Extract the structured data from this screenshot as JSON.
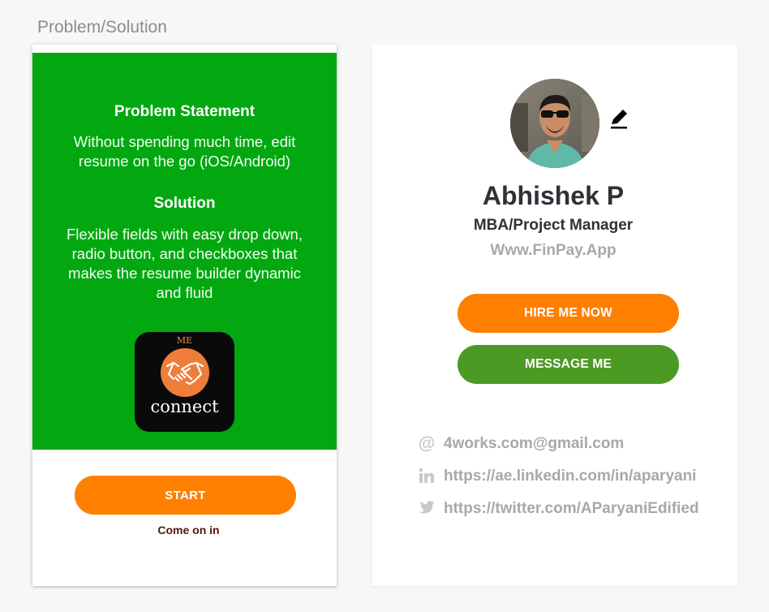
{
  "section": {
    "title": "Problem/Solution"
  },
  "phone": {
    "problem_heading": "Problem Statement",
    "problem_text": "Without spending much time, edit resume on the go (iOS/Android)",
    "solution_heading": "Solution",
    "solution_text": "Flexible fields with easy drop down, radio button, and checkboxes that makes the resume builder dynamic and fluid",
    "app_icon": {
      "top_text": "ME",
      "name": "connect",
      "logo_icon": "handshake-icon"
    },
    "start_label": "START",
    "tagline": "Come on in",
    "colors": {
      "panel": "#03a811",
      "start_button": "#ff7f00",
      "tagline": "#5a1500"
    }
  },
  "profile": {
    "avatar_icon": "avatar-photo",
    "edit_icon": "pencil-icon",
    "name": "Abhishek P",
    "title": "MBA/Project Manager",
    "website": "Www.FinPay.App",
    "hire_label": "HIRE ME NOW",
    "message_label": "MESSAGE ME",
    "contacts": [
      {
        "icon": "at-icon",
        "text": "4works.com@gmail.com"
      },
      {
        "icon": "linkedin-icon",
        "text": "https://ae.linkedin.com/in/aparyani"
      },
      {
        "icon": "twitter-icon",
        "text": "https://twitter.com/AParyaniEdified"
      }
    ],
    "colors": {
      "hire_button": "#ff7f00",
      "message_button": "#4c9a23",
      "muted_text": "#a8a8a8",
      "name_text": "#2f3136"
    }
  }
}
